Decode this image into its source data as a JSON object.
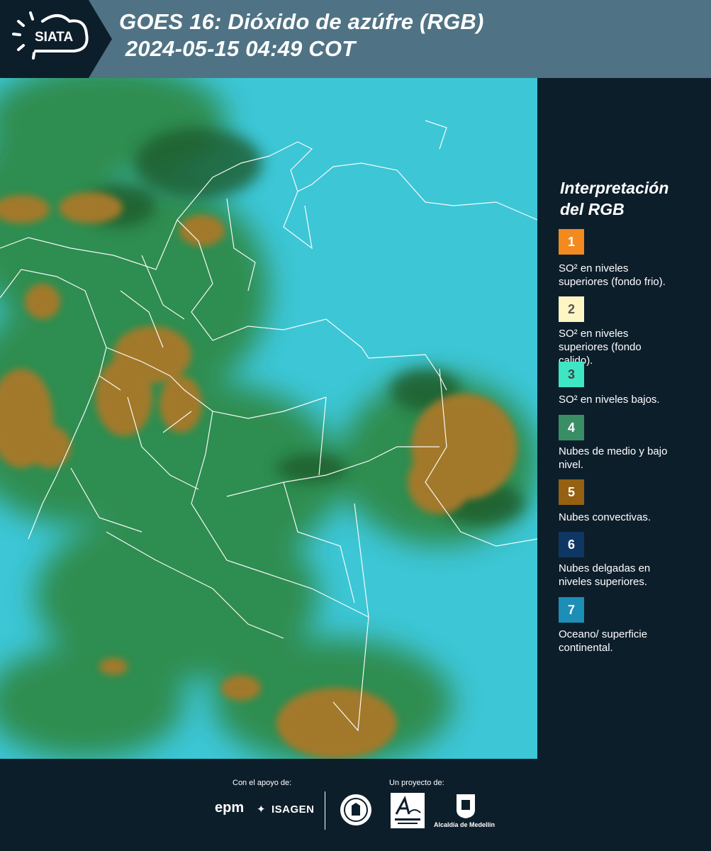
{
  "header": {
    "logo_text": "SIATA",
    "title_line1": "GOES 16: Dióxido de azúfre (RGB)",
    "title_line2": " 2024-05-15 04:49 COT"
  },
  "legend": {
    "title_line1": "Interpretación",
    "title_line2": "del RGB",
    "items": [
      {
        "number": "1",
        "color": "#f28a1f",
        "text_color": "#ffffff",
        "desc_line1": "SO² en niveles",
        "desc_line2": "superiores (fondo frio)."
      },
      {
        "number": "2",
        "color": "#fdf6c4",
        "text_color": "#555555",
        "desc_line1": "SO² en niveles",
        "desc_line2": "superiores (fondo",
        "desc_line3": "calido)."
      },
      {
        "number": "3",
        "color": "#3ee6c4",
        "text_color": "#444444",
        "desc_line1": "SO² en niveles bajos."
      },
      {
        "number": "4",
        "color": "#3a8e66",
        "text_color": "#ffffff",
        "desc_line1": "Nubes de medio y bajo",
        "desc_line2": "nivel."
      },
      {
        "number": "5",
        "color": "#966012",
        "text_color": "#ffffff",
        "desc_line1": "Nubes convectivas."
      },
      {
        "number": "6",
        "color": "#0f3763",
        "text_color": "#ffffff",
        "desc_line1": "Nubes delgadas en",
        "desc_line2": "niveles superiores."
      },
      {
        "number": "7",
        "color": "#1d8eb6",
        "text_color": "#ffffff",
        "desc_line1": "Oceano/ superficie",
        "desc_line2": "continental."
      }
    ]
  },
  "footer": {
    "support_label": "Con el apoyo de:",
    "project_label": "Un proyecto de:",
    "epm": "epm",
    "isagen": "ISAGEN",
    "alcaldia": "Alcaldía de Medellín"
  },
  "colors": {
    "header_bg": "#4f7384",
    "logo_tab_bg": "#0d1e2b",
    "panel_bg": "#0d1e2b",
    "map_cyan": "#35c3d4",
    "map_green": "#2e8a4a",
    "map_dark_green": "#1f5a2c",
    "map_brown": "#a2792a"
  }
}
